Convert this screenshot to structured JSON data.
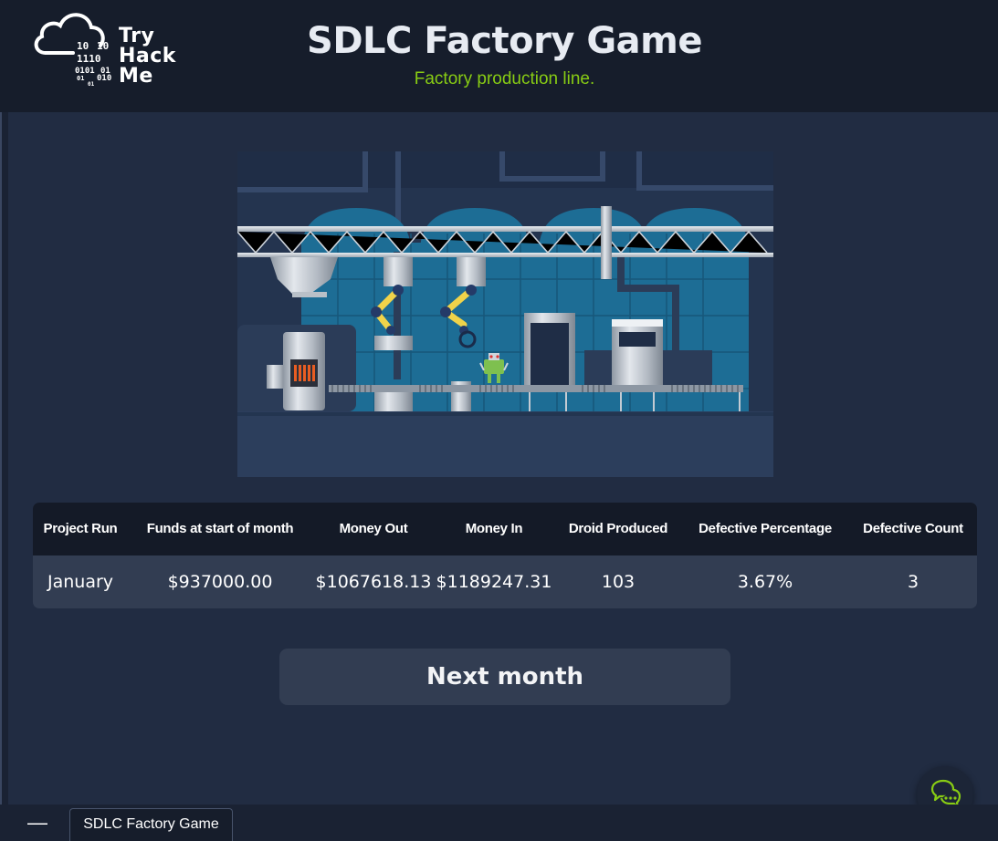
{
  "header": {
    "logo_lines": [
      "Try",
      "Hack",
      "Me"
    ],
    "title": "SDLC Factory Game",
    "subtitle": "Factory production line."
  },
  "colors": {
    "accent_green": "#88cc14",
    "header_bg": "#161d2b",
    "page_bg": "#212c42",
    "panel_bg": "#323d52"
  },
  "stats_table": {
    "headers": [
      "Project Run",
      "Funds at start of month",
      "Money Out",
      "Money In",
      "Droid Produced",
      "Defective Percentage",
      "Defective Count"
    ],
    "row": [
      "January",
      "$937000.00",
      "$1067618.13",
      "$1189247.31",
      "103",
      "3.67%",
      "3"
    ]
  },
  "next_button": {
    "label": "Next month"
  },
  "chat": {
    "icon": "chat-bubbles-icon"
  },
  "taskbar": {
    "minimize_icon": "minimize-icon",
    "minimize_glyph": "—",
    "window_title": "SDLC Factory Game"
  }
}
